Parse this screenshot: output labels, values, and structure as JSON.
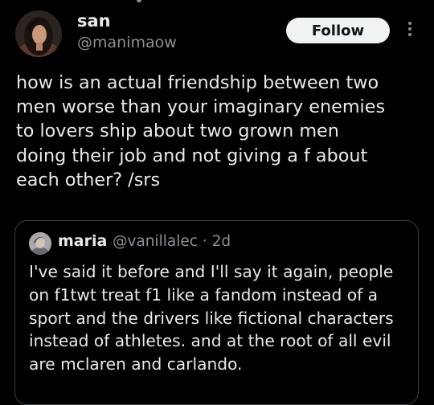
{
  "tweet": {
    "author_name": "san",
    "author_handle": "@manimaow",
    "follow_label": "Follow",
    "text": "how is an actual friendship between two\nmen worse than your imaginary enemies\nto lovers ship about two grown men\ndoing their job and not giving a f about\neach other? /srs"
  },
  "quoted_tweet": {
    "author_name": "maria",
    "author_handle_time": "@vanillalec · 2d",
    "text": "I've said it before and I'll say it again, people\non f1twt treat f1 like a fandom instead of a\nsport and the drivers like fictional characters\ninstead of athletes. and at the root of all evil\nare mclaren and carlando."
  },
  "icons": [
    "more-options-icon"
  ],
  "colors": {
    "background": "#000000",
    "text_primary": "#e7e9ea",
    "text_secondary": "#8b9096",
    "follow_button_bg": "#eff3f4",
    "border": "#3a3f44"
  }
}
